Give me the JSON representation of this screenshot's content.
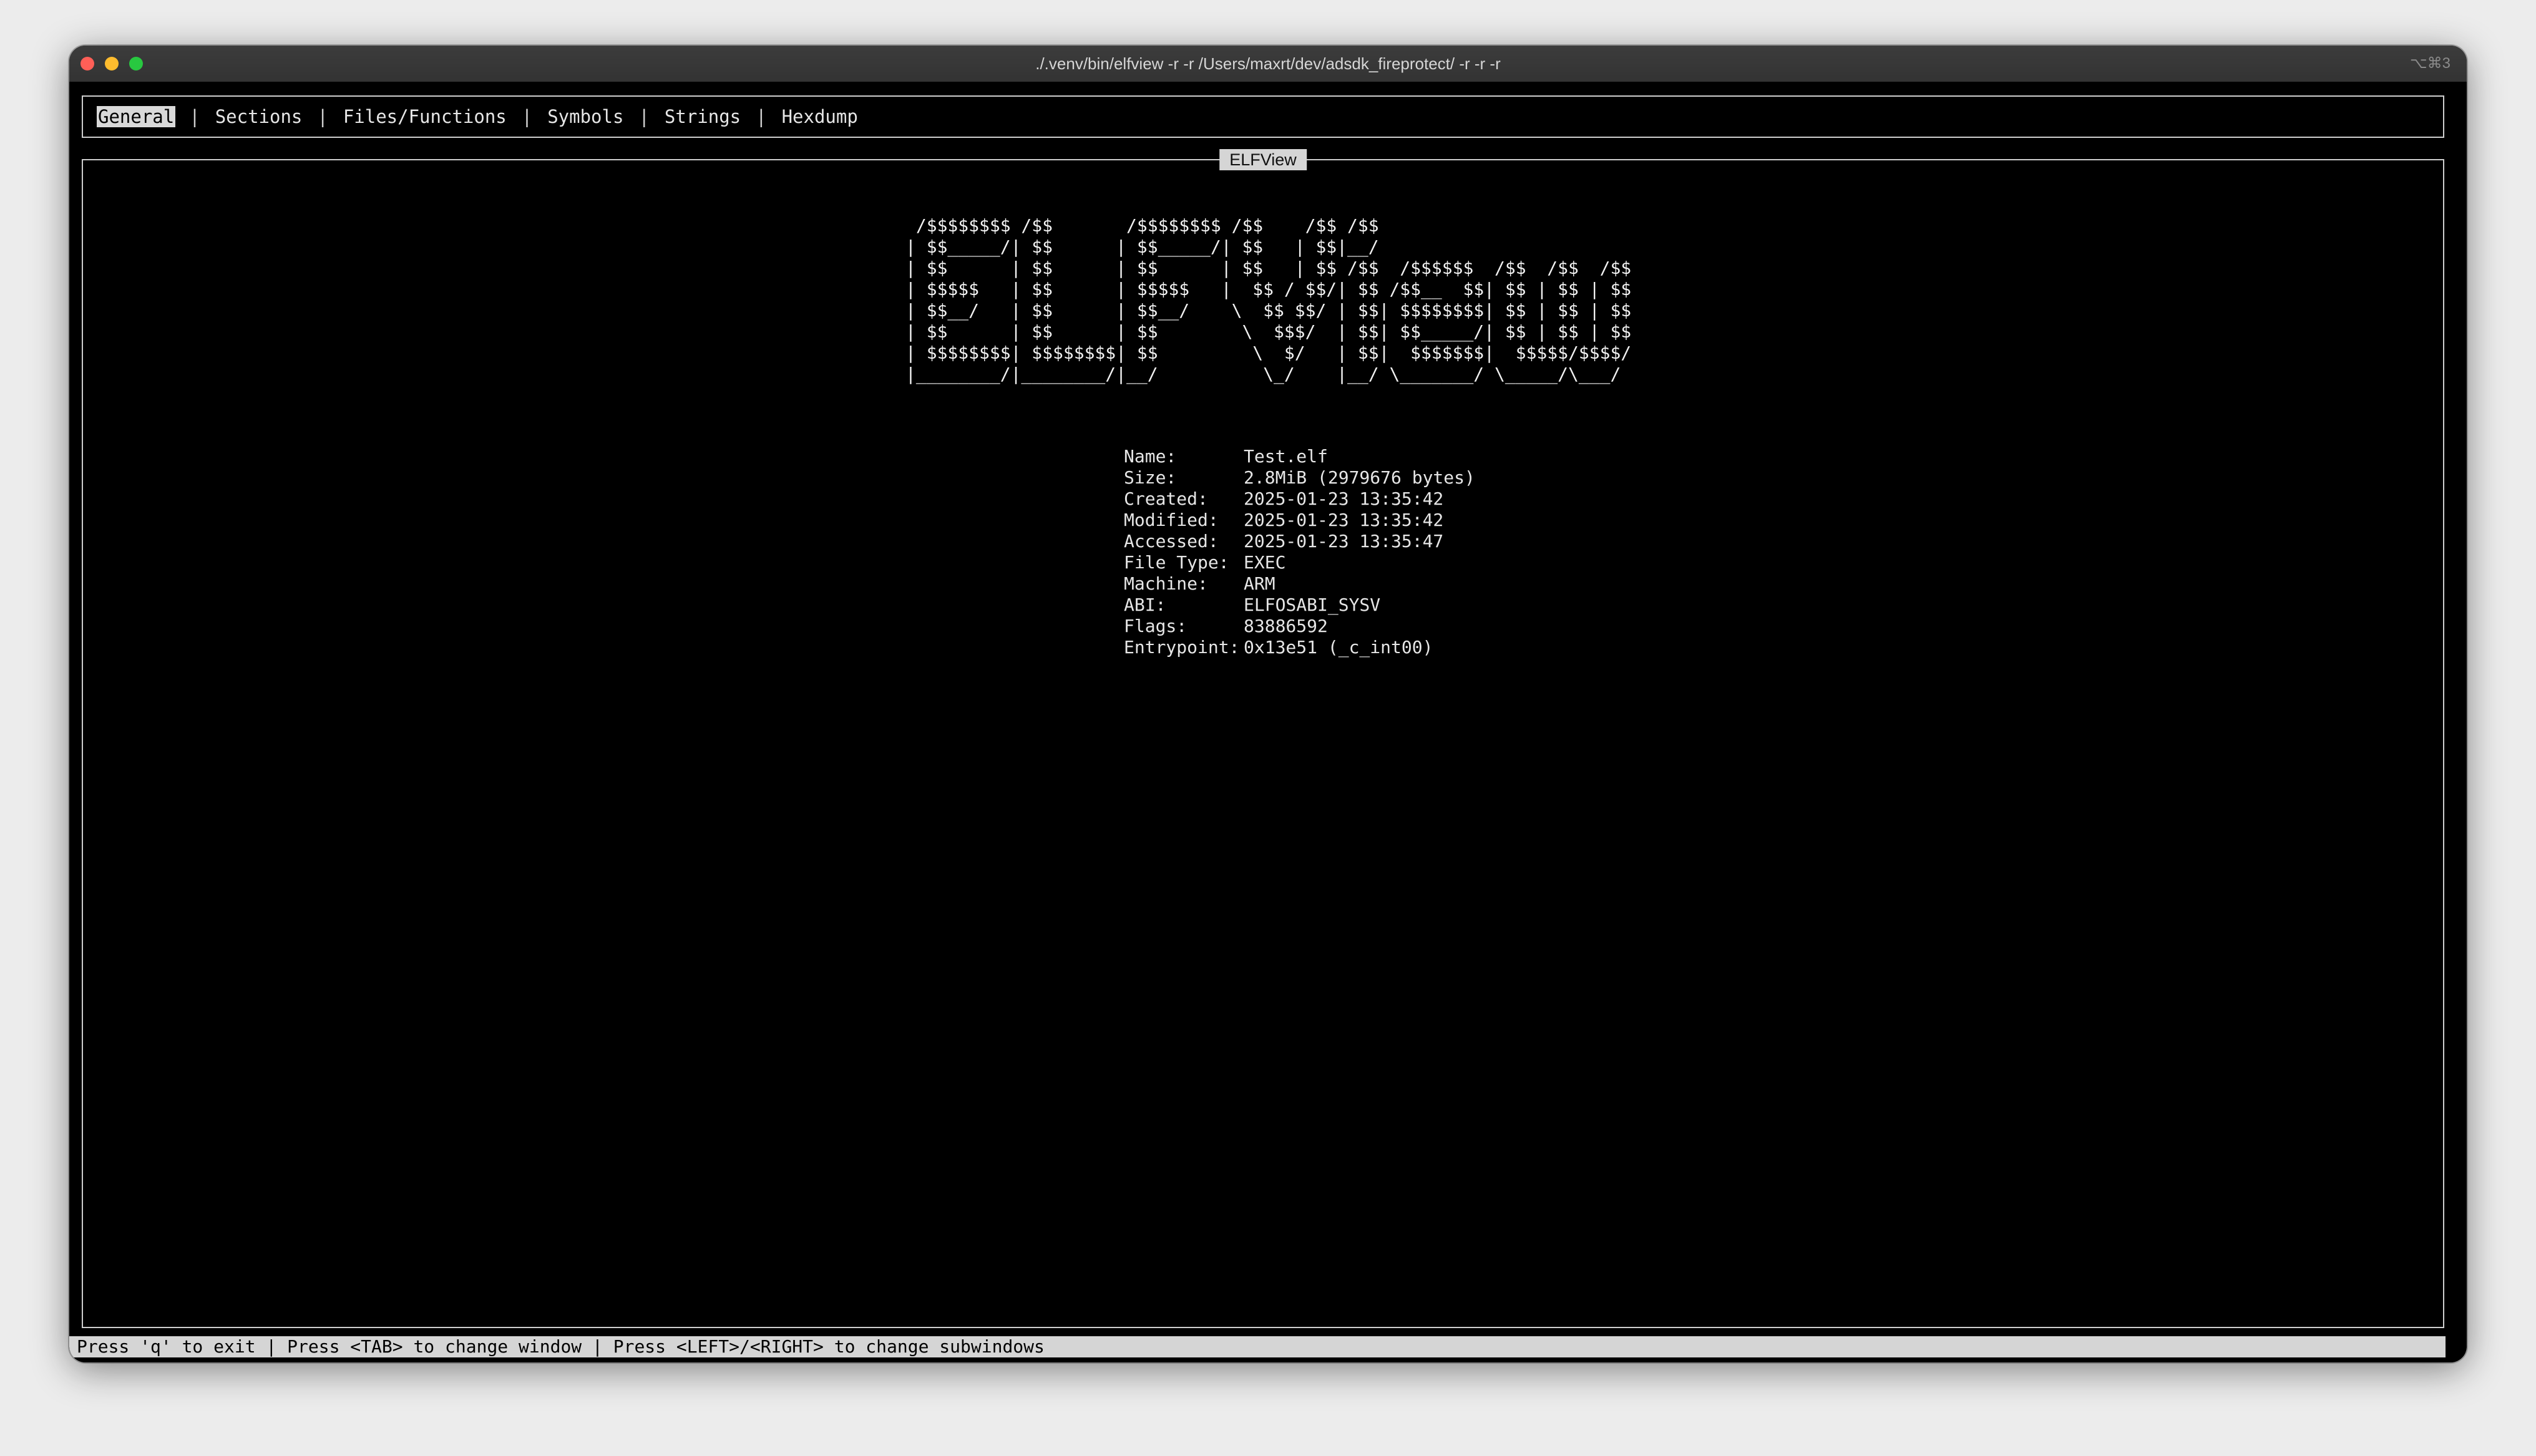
{
  "window": {
    "title": "./.venv/bin/elfview -r -r /Users/maxrt/dev/adsdk_fireprotect/ -r -r -r",
    "shortcut": "⌥⌘3"
  },
  "tabs": [
    {
      "label": "General",
      "active": true
    },
    {
      "label": "Sections",
      "active": false
    },
    {
      "label": "Files/Functions",
      "active": false
    },
    {
      "label": "Symbols",
      "active": false
    },
    {
      "label": "Strings",
      "active": false
    },
    {
      "label": "Hexdump",
      "active": false
    }
  ],
  "panel": {
    "title": "ELFView",
    "banner": " /$$$$$$$$ /$$       /$$$$$$$$ /$$    /$$ /$$\n| $$_____/| $$      | $$_____/| $$   | $$|__/\n| $$      | $$      | $$      | $$   | $$ /$$  /$$$$$$  /$$  /$$  /$$\n| $$$$$   | $$      | $$$$$   |  $$ / $$/| $$ /$$__  $$| $$ | $$ | $$\n| $$__/   | $$      | $$__/    \\  $$ $$/ | $$| $$$$$$$$| $$ | $$ | $$\n| $$      | $$      | $$        \\  $$$/  | $$| $$_____/| $$ | $$ | $$\n| $$$$$$$$| $$$$$$$$| $$         \\  $/   | $$|  $$$$$$$|  $$$$$/$$$$/\n|________/|________/|__/          \\_/    |__/ \\_______/ \\_____/\\___/"
  },
  "info": [
    {
      "key": "Name:",
      "value": "Test.elf"
    },
    {
      "key": "Size:",
      "value": "2.8MiB (2979676 bytes)"
    },
    {
      "key": "Created:",
      "value": "2025-01-23 13:35:42"
    },
    {
      "key": "Modified:",
      "value": "2025-01-23 13:35:42"
    },
    {
      "key": "Accessed:",
      "value": "2025-01-23 13:35:47"
    },
    {
      "key": "File Type:",
      "value": "EXEC"
    },
    {
      "key": "Machine:",
      "value": "ARM"
    },
    {
      "key": "ABI:",
      "value": "ELFOSABI_SYSV"
    },
    {
      "key": "Flags:",
      "value": "83886592"
    },
    {
      "key": "Entrypoint:",
      "value": "0x13e51 (_c_int00)"
    }
  ],
  "statusbar": {
    "text": "Press 'q' to exit | Press <TAB> to change window | Press <LEFT>/<RIGHT> to change subwindows"
  },
  "colors": {
    "background": "#000000",
    "foreground": "#e8e8e8",
    "highlight": "#d9d9d9",
    "close": "#ff5f57",
    "minimize": "#febc2e",
    "maximize": "#28c840"
  }
}
